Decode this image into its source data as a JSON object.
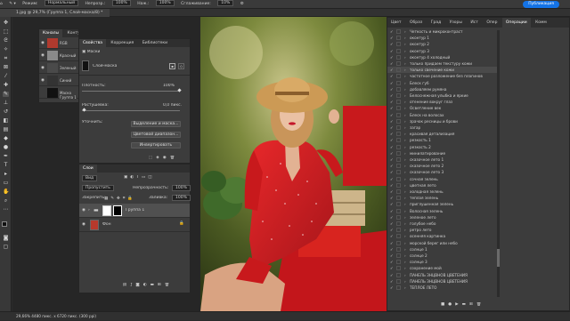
{
  "options_bar": {
    "mode_label": "Режим:",
    "mode_value": "Нормальный",
    "opacity_label": "Непрозр.:",
    "opacity_value": "100%",
    "flow_label": "Наж.:",
    "flow_value": "100%",
    "smoothing_label": "Сглаживание:",
    "smoothing_value": "10%",
    "share_label": "Публикация"
  },
  "doc_tab": {
    "title": "1.jpg @ 29,7% (Группа 1, Слой-маска/8) *"
  },
  "channels": {
    "tabs": [
      "Каналы",
      "Контуры"
    ],
    "rows": [
      {
        "name": "RGB",
        "color": "#b03a2e"
      },
      {
        "name": "Красный",
        "color": "#8a8a8a"
      },
      {
        "name": "Зеленый",
        "color": "#4a4a4a"
      },
      {
        "name": "Синий",
        "color": "#333333"
      },
      {
        "name": "Маска Группа 1",
        "color": "#111111"
      }
    ]
  },
  "properties": {
    "tabs": [
      "Свойства",
      "Коррекция",
      "Библиотеки"
    ],
    "section": "Маски",
    "mask_label": "Слой-маска",
    "density_label": "Плотность:",
    "density_value": "100%",
    "feather_label": "Растушевка:",
    "feather_value": "0,0 пикс.",
    "refine_label": "Уточнить:",
    "btn_select_mask": "Выделение и маска...",
    "btn_color_range": "Цветовой диапазон...",
    "btn_invert": "Инвертировать"
  },
  "layers": {
    "tab": "Слои",
    "search_label": "Вид",
    "blend_mode": "Пропустить",
    "opacity_label": "Непрозрачность:",
    "opacity_value": "100%",
    "lock_label": "Закрепить:",
    "fill_label": "Заливка:",
    "fill_value": "100%",
    "rows": [
      {
        "name": "Группа 1"
      },
      {
        "name": "Фон"
      }
    ]
  },
  "right_panel": {
    "tabs": [
      "Цвет",
      "Образ",
      "Град",
      "Узоры",
      "Ист",
      "Опер",
      "Операции",
      "Комм"
    ],
    "active_tab": "Операции",
    "items": [
      "Четкость и микроконтраст",
      "оконтур 1",
      "оконтур 2",
      "оконтур 3",
      "оконтур 4 холодный",
      "только придаем текстуру кожи",
      "только свечение кожи",
      "частотное разложение без плагинов",
      "Блеск губ",
      "добавляем румяна",
      "Белоснежная улыбка и яркие",
      "отенение вокруг глаз",
      "Осветление век",
      "Блеск на волосах",
      "зрачок ресницы и брови",
      "загар",
      "красивая детализация",
      "резкость 1",
      "резкость 2",
      "минилатирование",
      "сказочное лето 1",
      "сказочное лето 2",
      "сказочное лето 3",
      "сочная зелень",
      "цветная лето",
      "холодная зелень",
      "теплая зелень",
      "приглушенная зелень",
      "Волосная зелень",
      "зеленое лето",
      "голубое небо",
      "ретро лето",
      "осенняя картинка",
      "морской берег или небо",
      "солнце 1",
      "солнце 2",
      "солнце 3",
      "сохранение мой",
      "ПАНЕЛЬ ЗНЦВНОВ ЦВЕТЕНИЯ",
      "ПАНЕЛЬ ЗНЦВНОВ ЦВЕТЕНИЯ",
      "ТЕПЛОЕ ЛЕТО"
    ],
    "selected_index": 6
  },
  "status_bar": {
    "text": "29,66%   4480 пикс. х 6720 пикс. (300 ppi)"
  }
}
